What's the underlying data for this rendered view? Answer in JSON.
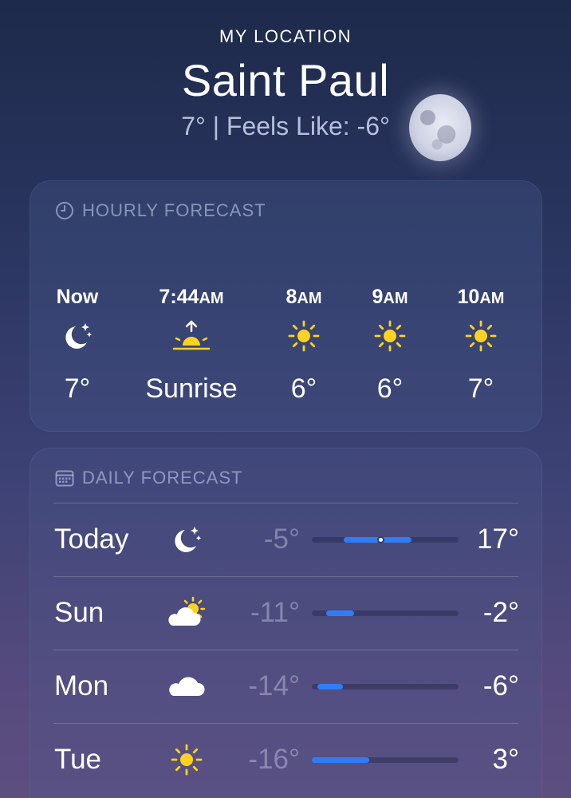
{
  "header": {
    "location_label": "MY LOCATION",
    "city": "Saint Paul",
    "current_line": "7°  |  Feels Like: -6°"
  },
  "hourly": {
    "title": "HOURLY FORECAST",
    "items": [
      {
        "time": "Now",
        "ampm": "",
        "icon": "moon-stars-icon",
        "value": "7°"
      },
      {
        "time": "7:44",
        "ampm": "AM",
        "icon": "sunrise-icon",
        "value": "Sunrise"
      },
      {
        "time": "8",
        "ampm": "AM",
        "icon": "sun-icon",
        "value": "6°"
      },
      {
        "time": "9",
        "ampm": "AM",
        "icon": "sun-icon",
        "value": "6°"
      },
      {
        "time": "10",
        "ampm": "AM",
        "icon": "sun-icon",
        "value": "7°"
      }
    ]
  },
  "daily": {
    "title": "DAILY FORECAST",
    "days": [
      {
        "day": "Today",
        "icon": "moon-stars-icon",
        "low": "-5°",
        "high": "17°",
        "range_start": 0.22,
        "range_end": 0.68,
        "current_dot": 0.47
      },
      {
        "day": "Sun",
        "icon": "partly-cloudy-icon",
        "low": "-11°",
        "high": "-2°",
        "range_start": 0.1,
        "range_end": 0.29
      },
      {
        "day": "Mon",
        "icon": "cloud-icon",
        "low": "-14°",
        "high": "-6°",
        "range_start": 0.04,
        "range_end": 0.21
      },
      {
        "day": "Tue",
        "icon": "sun-icon",
        "low": "-16°",
        "high": "3°",
        "range_start": 0.0,
        "range_end": 0.39
      }
    ]
  },
  "colors": {
    "accent_blue": "#2f7df6",
    "sun_yellow": "#ffd21f"
  }
}
